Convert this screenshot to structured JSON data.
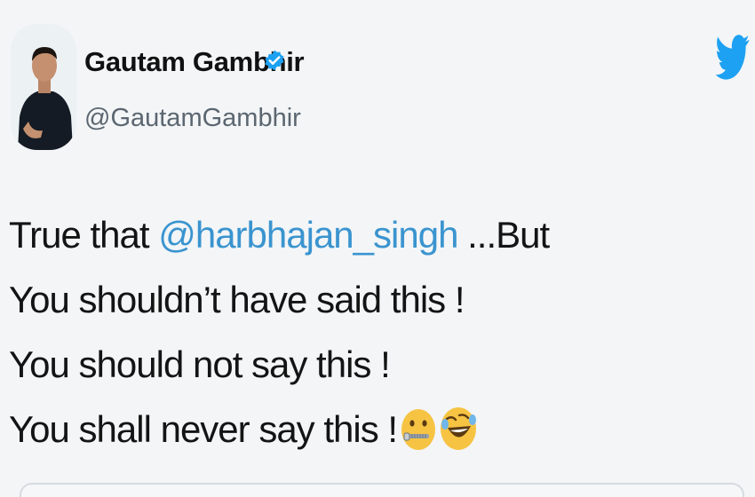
{
  "author": {
    "display_name": "Gautam Gambhir",
    "handle": "@GautamGambhir",
    "verified": true
  },
  "icons": {
    "avatar": "profile-photo",
    "verified": "verified-badge-icon",
    "brand": "twitter-bird-icon",
    "emoji_1": "zipper-mouth-face-emoji",
    "emoji_2": "rolling-on-the-floor-laughing-emoji"
  },
  "tweet": {
    "line1_prefix": "True that",
    "mention": "@harbhajan_singh",
    "line1_suffix": "...But",
    "line2": "You shouldn’t have said this !",
    "line3": "You should not say this !",
    "line4": "You shall never say this !"
  },
  "colors": {
    "background": "#f3f5f7",
    "mention": "#3a94cf",
    "twitter_blue": "#1da1f2",
    "handle": "#5b6670"
  }
}
